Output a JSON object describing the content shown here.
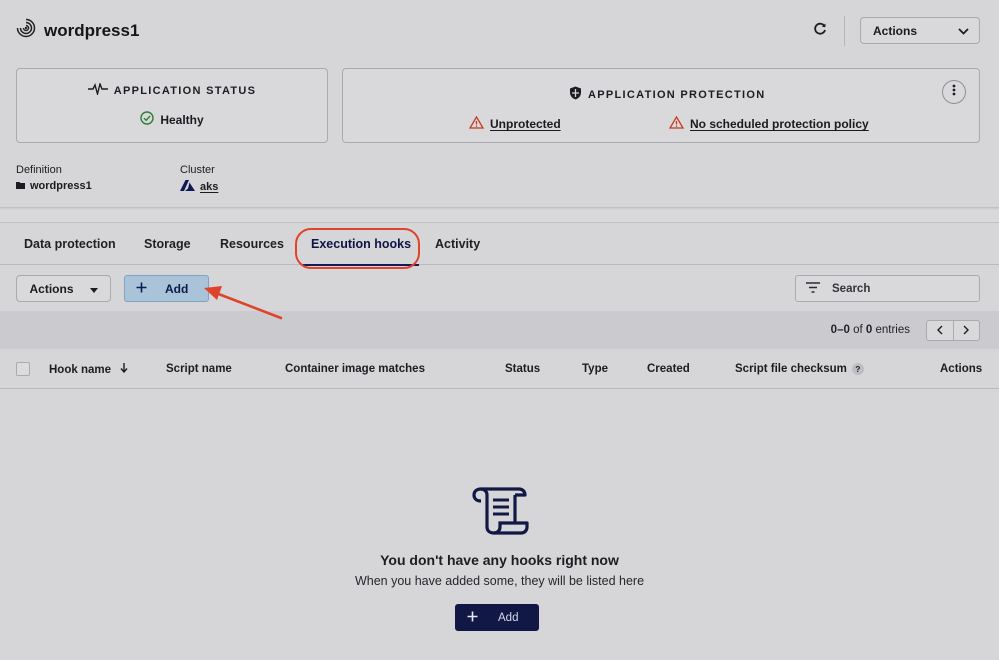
{
  "app": {
    "title": "wordpress1"
  },
  "header": {
    "actions_label": "Actions"
  },
  "status_card": {
    "heading": "APPLICATION STATUS",
    "status": "Healthy",
    "status_color": "#2e7d32"
  },
  "protection_card": {
    "heading": "APPLICATION PROTECTION",
    "warning_1": "Unprotected",
    "warning_2": "No scheduled protection policy",
    "warning_color": "#c43a1c"
  },
  "meta": {
    "definition_label": "Definition",
    "definition_value": "wordpress1",
    "cluster_label": "Cluster",
    "cluster_value": "aks"
  },
  "tabs": [
    {
      "label": "Data protection",
      "active": false
    },
    {
      "label": "Storage",
      "active": false
    },
    {
      "label": "Resources",
      "active": false
    },
    {
      "label": "Execution hooks",
      "active": true
    },
    {
      "label": "Activity",
      "active": false
    }
  ],
  "toolbar": {
    "actions_label": "Actions",
    "add_label": "Add",
    "search_placeholder": "Search"
  },
  "pager": {
    "range": "0–0",
    "of": "of",
    "total": "0",
    "suffix": "entries"
  },
  "table": {
    "columns": [
      "Hook name",
      "Script name",
      "Container image matches",
      "Status",
      "Type",
      "Created",
      "Script file checksum",
      "Actions"
    ],
    "help_mark": "?",
    "rows": []
  },
  "empty": {
    "title": "You don't have any hooks right now",
    "subtitle": "When you have added some, they will be listed here",
    "add_label": "Add"
  },
  "colors": {
    "accent": "#121845",
    "highlight": "#e0432c",
    "add_button_bg": "#a9c3d8"
  },
  "icons": [
    "app-logo-icon",
    "refresh-icon",
    "chevron-down-icon",
    "pulse-icon",
    "check-circle-icon",
    "shield-icon",
    "warning-icon",
    "kebab-icon",
    "folder-icon",
    "azure-icon",
    "caret-down-icon",
    "plus-icon",
    "filter-icon",
    "chevron-left-icon",
    "chevron-right-icon",
    "sort-down-icon",
    "help-icon",
    "scroll-icon"
  ]
}
